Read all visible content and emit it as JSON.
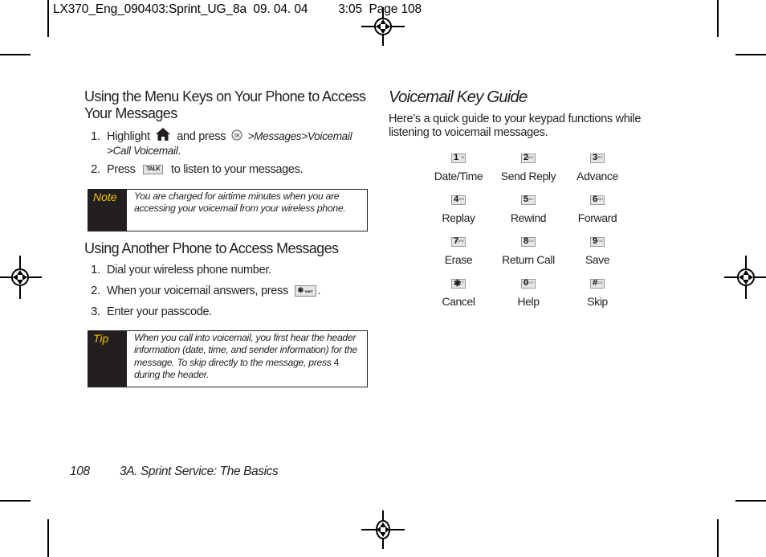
{
  "slug": {
    "file": "LX370_Eng_090403:Sprint_UG_8a",
    "date": "09. 04. 04",
    "time": "3:05",
    "page": "Page 108"
  },
  "left": {
    "section1": {
      "title": "Using the Menu Keys on Your Phone to Access Your Messages",
      "steps": [
        {
          "num": "1.",
          "pre": "Highlight",
          "icon1": "home-icon",
          "mid": "and press",
          "icon2": "menu-ok-key-icon",
          "path": ">Messages>Voicemail",
          "path2": ">Call Voicemail",
          "end": "."
        },
        {
          "num": "2.",
          "pre": "Press",
          "key": "TALK",
          "post": "to listen to your messages."
        }
      ],
      "note": {
        "label": "Note",
        "text": "You are charged for airtime minutes when you are accessing your voicemail from your wireless phone."
      }
    },
    "section2": {
      "title": "Using Another Phone to Access Messages",
      "steps": [
        {
          "num": "1.",
          "text": "Dial your wireless phone number."
        },
        {
          "num": "2.",
          "pre": "When your voicemail answers, press",
          "key": "✱",
          "key_sub": "SHIFT",
          "post": "."
        },
        {
          "num": "3.",
          "text": "Enter your passcode."
        }
      ],
      "tip": {
        "label": "Tip",
        "text_pre": "When you call into voicemail, you first hear the header information (date, time, and sender information) for the message. To skip directly to the message, press",
        "key": "4",
        "text_post": "during the header."
      }
    }
  },
  "right": {
    "title": "Voicemail Key Guide",
    "intro": "Here’s a quick guide to your keypad functions while listening to voicemail messages.",
    "keys": [
      {
        "digit": "1",
        "sub": "✉",
        "function": "Date/Time"
      },
      {
        "digit": "2",
        "sub": "ABC",
        "function": "Send Reply"
      },
      {
        "digit": "3",
        "sub": "DEF",
        "function": "Advance"
      },
      {
        "digit": "4",
        "sub": "GHI",
        "function": "Replay"
      },
      {
        "digit": "5",
        "sub": "JKL",
        "function": "Rewind"
      },
      {
        "digit": "6",
        "sub": "MNO",
        "function": "Forward"
      },
      {
        "digit": "7",
        "sub": "PQRS",
        "function": "Erase"
      },
      {
        "digit": "8",
        "sub": "TUV",
        "function": "Return Call"
      },
      {
        "digit": "9",
        "sub": "WXYZ",
        "function": "Save"
      },
      {
        "digit": "✱",
        "sub": "SHIFT",
        "function": "Cancel"
      },
      {
        "digit": "0",
        "sub": "+ NEXT",
        "function": "Help"
      },
      {
        "digit": "#",
        "sub": "SPACE",
        "function": "Skip"
      }
    ]
  },
  "footer": {
    "page_number": "108",
    "section": "3A. Sprint Service: The Basics"
  }
}
